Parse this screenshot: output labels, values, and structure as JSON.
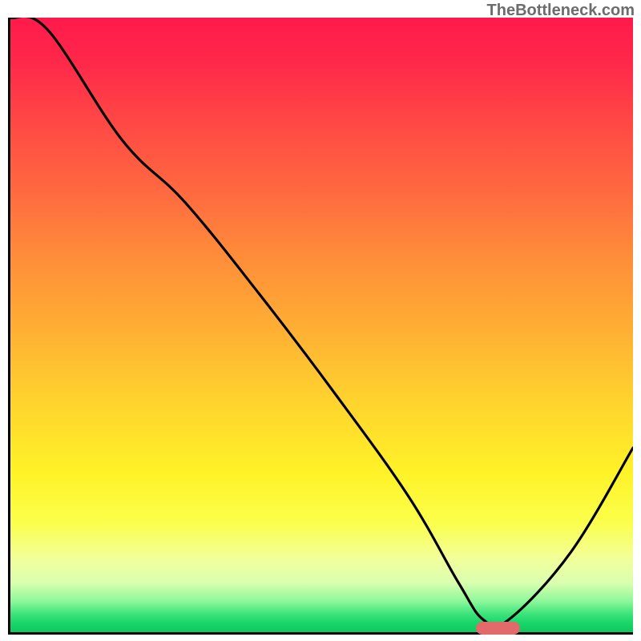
{
  "watermark": "TheBottleneck.com",
  "chart_data": {
    "type": "line",
    "title": "",
    "xlabel": "",
    "ylabel": "",
    "xlim": [
      0,
      100
    ],
    "ylim": [
      0,
      100
    ],
    "grid": false,
    "series": [
      {
        "name": "curve",
        "x": [
          0,
          6,
          18,
          28,
          40,
          52,
          64,
          72,
          76,
          80,
          90,
          100
        ],
        "values": [
          100,
          98,
          80,
          70,
          55,
          39,
          22,
          8,
          2,
          2,
          13,
          30
        ]
      }
    ],
    "optimal_marker": {
      "x_center": 78,
      "width_pct": 7,
      "y": 1
    },
    "background_gradient": {
      "stops": [
        {
          "pct": 0,
          "color": "#ff1a4b"
        },
        {
          "pct": 50,
          "color": "#ffad34"
        },
        {
          "pct": 82,
          "color": "#fbff4a"
        },
        {
          "pct": 100,
          "color": "#0bc95b"
        }
      ]
    }
  },
  "colors": {
    "curve": "#000000",
    "marker": "#e26a6a",
    "axis": "#000000",
    "watermark": "#6c6c6c"
  }
}
